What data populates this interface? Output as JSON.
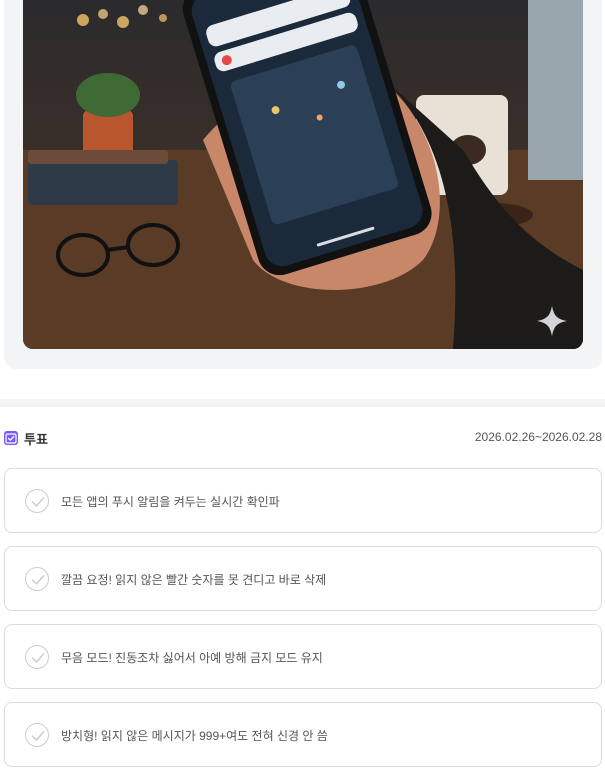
{
  "image": {
    "icon": "sparkle-icon"
  },
  "poll": {
    "title": "투표",
    "period": "2026.02.26~2026.02.28",
    "icon": "checkbox-icon",
    "accent": "#7a5af8",
    "options": [
      {
        "label": "모든 앱의 푸시 알림을 켜두는 실시간 확인파"
      },
      {
        "label": "깔끔 요정! 읽지 않은 빨간 숫자를 못 견디고 바로 삭제"
      },
      {
        "label": "무음 모드! 진동조차 싫어서 아예 방해 금지 모드 유지"
      },
      {
        "label": "방치형! 읽지 않은 메시지가 999+여도 전혀 신경 안 씀"
      }
    ]
  }
}
